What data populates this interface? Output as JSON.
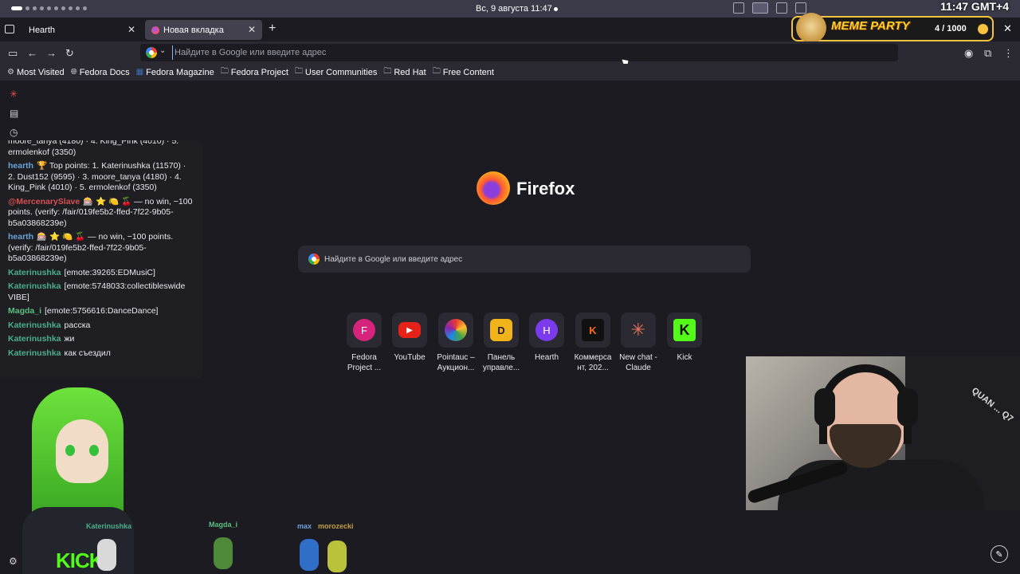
{
  "topbar": {
    "clock": "Вс, 9 августа  11:47",
    "gmt": "11:47 GMT+4"
  },
  "tabs": [
    {
      "label": "Hearth",
      "active": false
    },
    {
      "label": "Новая вкладка",
      "active": true
    }
  ],
  "meme_party": {
    "title": "MEME PARTY",
    "score": "4 / 1000"
  },
  "urlbar": {
    "placeholder": "Найдите в Google или введите адрес"
  },
  "bookmarks": [
    {
      "label": "Most Visited",
      "icon": "gear-icon"
    },
    {
      "label": "Fedora Docs",
      "icon": "globe-icon"
    },
    {
      "label": "Fedora Magazine",
      "icon": "fedora-magazine-icon"
    },
    {
      "label": "Fedora Project",
      "icon": "folder-icon"
    },
    {
      "label": "User Communities",
      "icon": "folder-icon"
    },
    {
      "label": "Red Hat",
      "icon": "folder-icon"
    },
    {
      "label": "Free Content",
      "icon": "folder-icon"
    }
  ],
  "newtab": {
    "brand": "Firefox",
    "search_placeholder": "Найдите в Google или введите адрес",
    "tiles": [
      {
        "label": "Fedora Project ...",
        "letter": "F",
        "color": "#d6247c"
      },
      {
        "label": "YouTube",
        "letter": "▶",
        "color": "#e62117"
      },
      {
        "label": "Pointauc – Аукцион...",
        "letter": "✺",
        "color": "#2b2a33"
      },
      {
        "label": "Панель управле...",
        "letter": "D",
        "color": "#f0b31a"
      },
      {
        "label": "Hearth",
        "letter": "H",
        "color": "#7c3aed"
      },
      {
        "label": "Коммерса нт, 202...",
        "letter": "K",
        "color": "#111111"
      },
      {
        "label": "New chat - Claude",
        "letter": "✳",
        "color": "#2b2a33"
      },
      {
        "label": "Kick",
        "letter": "K",
        "color": "#53fc18"
      }
    ]
  },
  "chat": {
    "messages": [
      {
        "nick": "",
        "text": "moore_tanya (4180) · 4. King_Pink (4010) · 5. ermolenkof (3350)",
        "cls": ""
      },
      {
        "nick": "hearth",
        "text": "🏆 Top points: 1. Katerinushka (11570) · 2. Dust152 (9595) · 3. moore_tanya (4180) · 4. King_Pink (4010) · 5. ermolenkof (3350)",
        "cls": "n-hearth"
      },
      {
        "nick": "@MercenarySlave",
        "text": "🎰 ⭐ 🍋 🍒 — no win, −100 points. (verify: /fair/019fe5b2-ffed-7f22-9b05-b5a03868239e)",
        "cls": "n-merc"
      },
      {
        "nick": "hearth",
        "text": "🎰 ⭐ 🍋 🍒 — no win, −100 points. (verify: /fair/019fe5b2-ffed-7f22-9b05-b5a03868239e)",
        "cls": "n-hearth"
      },
      {
        "nick": "Katerinushka",
        "text": "[emote:39265:EDMusiC]",
        "cls": "n-kat"
      },
      {
        "nick": "Katerinushka",
        "text": "[emote:5748033:collectibleswide VIBE]",
        "cls": "n-kat"
      },
      {
        "nick": "Magda_i",
        "text": "[emote:5756616:DanceDance]",
        "cls": "n-magda"
      },
      {
        "nick": "Katerinushka",
        "text": "расска",
        "cls": "n-kat"
      },
      {
        "nick": "Katerinushka",
        "text": "жи",
        "cls": "n-kat"
      },
      {
        "nick": "Katerinushka",
        "text": "как съездил",
        "cls": "n-kat"
      }
    ]
  },
  "viewers": [
    "Katerinushka",
    "Magda_i",
    "max",
    "morozecki"
  ],
  "vtuber_shirt": "KICK",
  "webcam_chair_text": "QUAN ... Q7"
}
